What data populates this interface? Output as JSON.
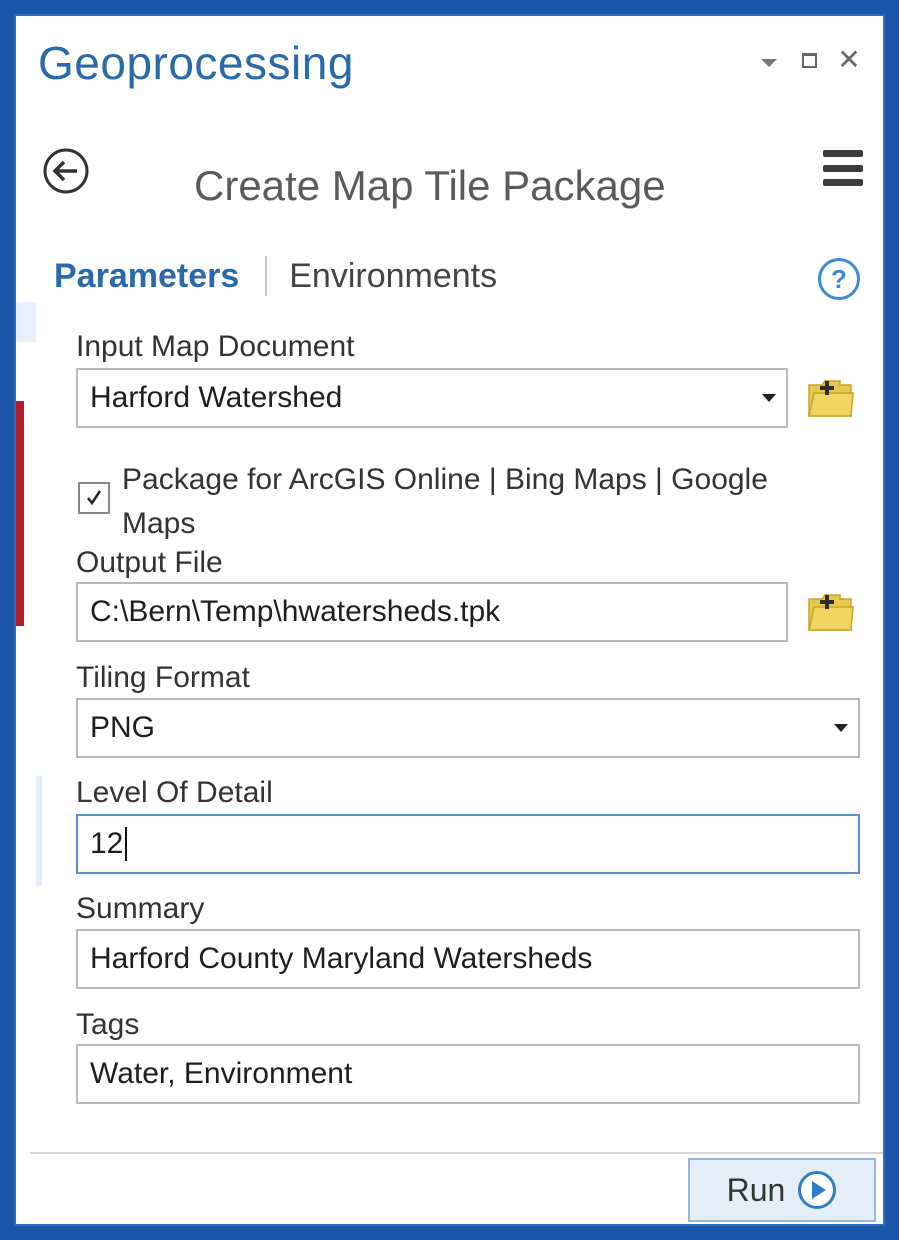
{
  "window": {
    "title": "Geoprocessing"
  },
  "tool": {
    "title": "Create Map Tile Package"
  },
  "tabs": {
    "parameters": "Parameters",
    "environments": "Environments"
  },
  "fields": {
    "input_map": {
      "label": "Input Map Document",
      "value": "Harford Watershed"
    },
    "package_option": {
      "label": "Package for ArcGIS Online | Bing Maps | Google Maps",
      "checked": true
    },
    "output_file": {
      "label": "Output File",
      "value": "C:\\Bern\\Temp\\hwatersheds.tpk"
    },
    "tiling_format": {
      "label": "Tiling Format",
      "value": "PNG"
    },
    "level_of_detail": {
      "label": "Level Of Detail",
      "value": "12"
    },
    "summary": {
      "label": "Summary",
      "value": "Harford County Maryland Watersheds"
    },
    "tags": {
      "label": "Tags",
      "value": "Water, Environment"
    }
  },
  "footer": {
    "run_label": "Run"
  },
  "colors": {
    "accent": "#2a6aa8",
    "frame": "#1d55a8",
    "folder_icon": "#e8c84a",
    "run_button_bg": "#e4eef8"
  },
  "icons": [
    "back-arrow-icon",
    "pin-icon",
    "maximize-icon",
    "close-icon",
    "menu-icon",
    "help-icon",
    "add-folder-icon",
    "play-icon",
    "checkmark-icon"
  ]
}
